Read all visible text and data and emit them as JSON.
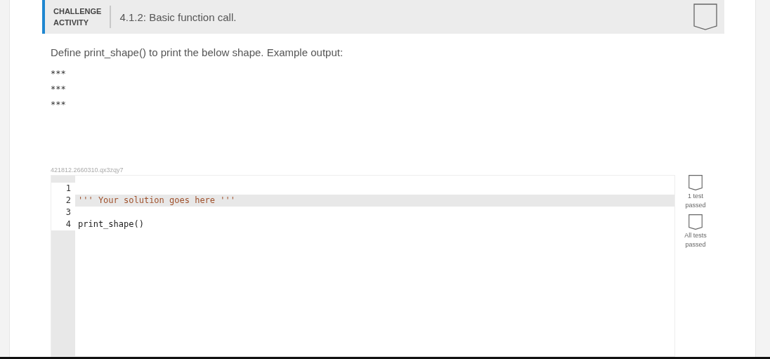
{
  "header": {
    "label_lines": [
      "CHALLENGE",
      "ACTIVITY"
    ],
    "title": "4.1.2: Basic function call."
  },
  "instructions": "Define print_shape() to print the below shape. Example output:",
  "example_output": [
    "***",
    "***",
    "***"
  ],
  "activity_id": "421812.2660310.qx3zqy7",
  "editor": {
    "lines": [
      {
        "number": "1",
        "kind": "blank",
        "active": false
      },
      {
        "number": "2",
        "text": "''' Your solution goes here '''",
        "kind": "string",
        "active": true
      },
      {
        "number": "3",
        "kind": "blank",
        "active": false
      },
      {
        "number": "4",
        "text": "print_shape()",
        "kind": "code",
        "active": false
      }
    ]
  },
  "tests": [
    {
      "label_lines": [
        "1 test",
        "passed"
      ]
    },
    {
      "label_lines": [
        "All tests",
        "passed"
      ]
    }
  ]
}
